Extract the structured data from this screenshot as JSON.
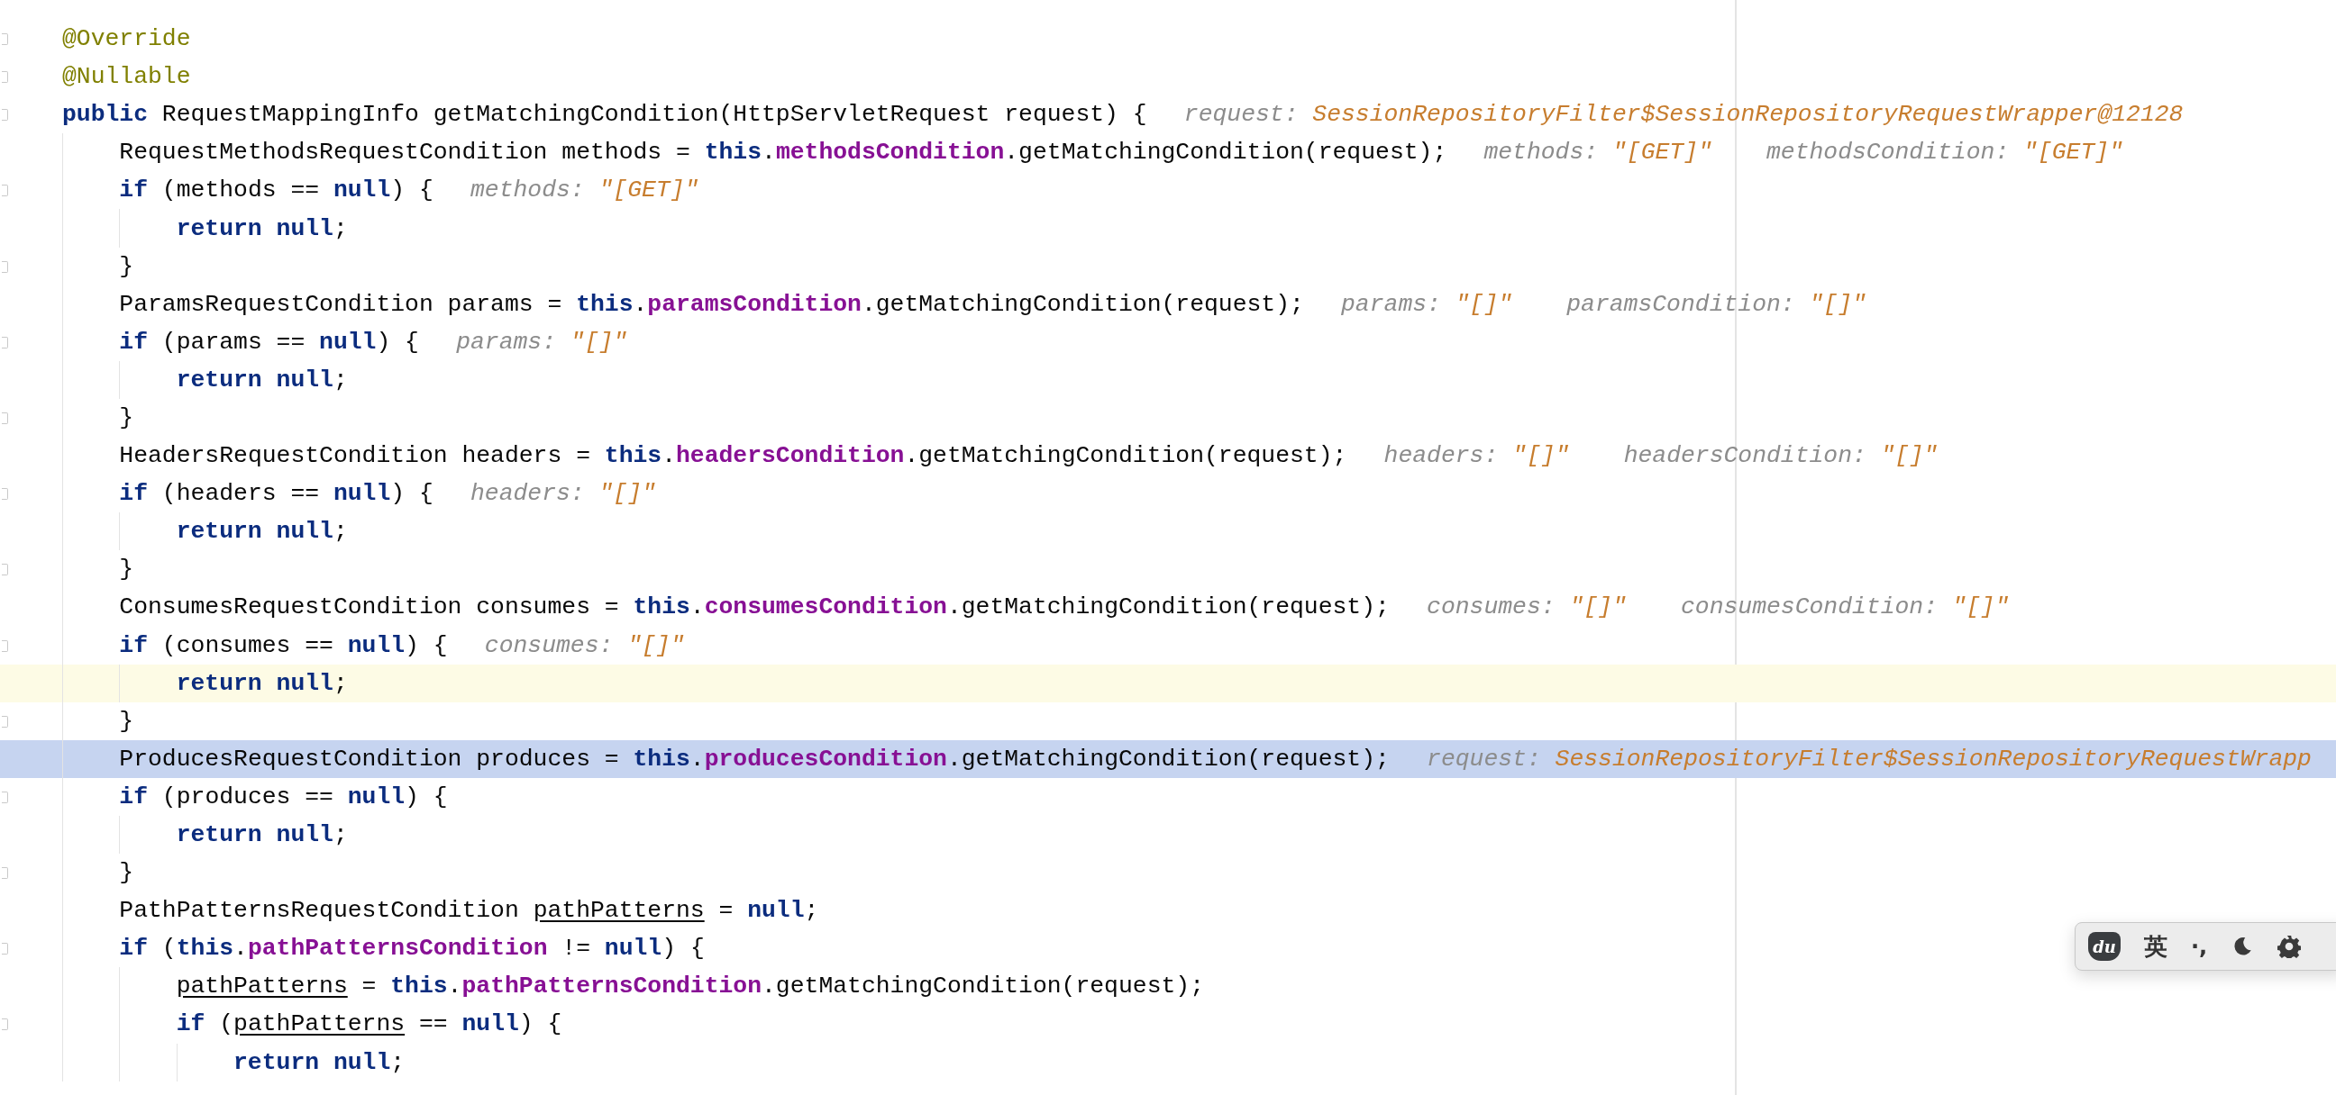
{
  "editor": {
    "lines": [
      {
        "foldable": true,
        "current_line": false,
        "execution_point": false,
        "code": [
          {
            "kind": "annotation",
            "text": "@Override"
          }
        ]
      },
      {
        "foldable": true,
        "current_line": false,
        "execution_point": false,
        "code": [
          {
            "kind": "annotation",
            "text": "@Nullable"
          }
        ]
      },
      {
        "foldable": true,
        "current_line": false,
        "execution_point": false,
        "code": [
          {
            "kind": "keyword",
            "text": "public"
          },
          {
            "kind": "plain",
            "text": " RequestMappingInfo getMatchingCondition(HttpServletRequest request) {"
          }
        ],
        "hints": [
          {
            "name": "request:",
            "value": "SessionRepositoryFilter$SessionRepositoryRequestWrapper@12128"
          }
        ],
        "children": [
          {
            "foldable": false,
            "current_line": false,
            "execution_point": false,
            "code": [
              {
                "kind": "plain",
                "text": "RequestMethodsRequestCondition methods = "
              },
              {
                "kind": "keyword",
                "text": "this"
              },
              {
                "kind": "plain",
                "text": "."
              },
              {
                "kind": "field",
                "text": "methodsCondition"
              },
              {
                "kind": "plain",
                "text": ".getMatchingCondition(request);"
              }
            ],
            "hints": [
              {
                "name": "methods:",
                "value": "\"[GET]\""
              },
              {
                "name": "methodsCondition:",
                "value": "\"[GET]\""
              }
            ]
          },
          {
            "foldable": true,
            "current_line": false,
            "execution_point": false,
            "code": [
              {
                "kind": "keyword",
                "text": "if"
              },
              {
                "kind": "plain",
                "text": " (methods == "
              },
              {
                "kind": "keyword",
                "text": "null"
              },
              {
                "kind": "plain",
                "text": ") {"
              }
            ],
            "hints": [
              {
                "name": "methods:",
                "value": "\"[GET]\""
              }
            ],
            "children": [
              {
                "foldable": false,
                "current_line": false,
                "execution_point": false,
                "code": [
                  {
                    "kind": "keyword",
                    "text": "return null"
                  },
                  {
                    "kind": "plain",
                    "text": ";"
                  }
                ]
              }
            ]
          },
          {
            "foldable": true,
            "current_line": false,
            "execution_point": false,
            "code": [
              {
                "kind": "plain",
                "text": "}"
              }
            ]
          },
          {
            "foldable": false,
            "current_line": false,
            "execution_point": false,
            "code": [
              {
                "kind": "plain",
                "text": "ParamsRequestCondition params = "
              },
              {
                "kind": "keyword",
                "text": "this"
              },
              {
                "kind": "plain",
                "text": "."
              },
              {
                "kind": "field",
                "text": "paramsCondition"
              },
              {
                "kind": "plain",
                "text": ".getMatchingCondition(request);"
              }
            ],
            "hints": [
              {
                "name": "params:",
                "value": "\"[]\""
              },
              {
                "name": "paramsCondition:",
                "value": "\"[]\""
              }
            ]
          },
          {
            "foldable": true,
            "current_line": false,
            "execution_point": false,
            "code": [
              {
                "kind": "keyword",
                "text": "if"
              },
              {
                "kind": "plain",
                "text": " (params == "
              },
              {
                "kind": "keyword",
                "text": "null"
              },
              {
                "kind": "plain",
                "text": ") {"
              }
            ],
            "hints": [
              {
                "name": "params:",
                "value": "\"[]\""
              }
            ],
            "children": [
              {
                "foldable": false,
                "current_line": false,
                "execution_point": false,
                "code": [
                  {
                    "kind": "keyword",
                    "text": "return null"
                  },
                  {
                    "kind": "plain",
                    "text": ";"
                  }
                ]
              }
            ]
          },
          {
            "foldable": true,
            "current_line": false,
            "execution_point": false,
            "code": [
              {
                "kind": "plain",
                "text": "}"
              }
            ]
          },
          {
            "foldable": false,
            "current_line": false,
            "execution_point": false,
            "code": [
              {
                "kind": "plain",
                "text": "HeadersRequestCondition headers = "
              },
              {
                "kind": "keyword",
                "text": "this"
              },
              {
                "kind": "plain",
                "text": "."
              },
              {
                "kind": "field",
                "text": "headersCondition"
              },
              {
                "kind": "plain",
                "text": ".getMatchingCondition(request);"
              }
            ],
            "hints": [
              {
                "name": "headers:",
                "value": "\"[]\""
              },
              {
                "name": "headersCondition:",
                "value": "\"[]\""
              }
            ]
          },
          {
            "foldable": true,
            "current_line": false,
            "execution_point": false,
            "code": [
              {
                "kind": "keyword",
                "text": "if"
              },
              {
                "kind": "plain",
                "text": " (headers == "
              },
              {
                "kind": "keyword",
                "text": "null"
              },
              {
                "kind": "plain",
                "text": ") {"
              }
            ],
            "hints": [
              {
                "name": "headers:",
                "value": "\"[]\""
              }
            ],
            "children": [
              {
                "foldable": false,
                "current_line": false,
                "execution_point": false,
                "code": [
                  {
                    "kind": "keyword",
                    "text": "return null"
                  },
                  {
                    "kind": "plain",
                    "text": ";"
                  }
                ]
              }
            ]
          },
          {
            "foldable": true,
            "current_line": false,
            "execution_point": false,
            "code": [
              {
                "kind": "plain",
                "text": "}"
              }
            ]
          },
          {
            "foldable": false,
            "current_line": false,
            "execution_point": false,
            "code": [
              {
                "kind": "plain",
                "text": "ConsumesRequestCondition consumes = "
              },
              {
                "kind": "keyword",
                "text": "this"
              },
              {
                "kind": "plain",
                "text": "."
              },
              {
                "kind": "field",
                "text": "consumesCondition"
              },
              {
                "kind": "plain",
                "text": ".getMatchingCondition(request);"
              }
            ],
            "hints": [
              {
                "name": "consumes:",
                "value": "\"[]\""
              },
              {
                "name": "consumesCondition:",
                "value": "\"[]\""
              }
            ]
          },
          {
            "foldable": true,
            "current_line": false,
            "execution_point": false,
            "code": [
              {
                "kind": "keyword",
                "text": "if"
              },
              {
                "kind": "plain",
                "text": " (consumes == "
              },
              {
                "kind": "keyword",
                "text": "null"
              },
              {
                "kind": "plain",
                "text": ") {"
              }
            ],
            "hints": [
              {
                "name": "consumes:",
                "value": "\"[]\""
              }
            ],
            "children": [
              {
                "foldable": false,
                "current_line": true,
                "execution_point": false,
                "code": [
                  {
                    "kind": "keyword",
                    "text": "return null"
                  },
                  {
                    "kind": "plain",
                    "text": ";"
                  }
                ]
              }
            ]
          },
          {
            "foldable": true,
            "current_line": false,
            "execution_point": false,
            "code": [
              {
                "kind": "plain",
                "text": "}"
              }
            ]
          },
          {
            "foldable": false,
            "current_line": false,
            "execution_point": true,
            "code": [
              {
                "kind": "plain",
                "text": "ProducesRequestCondition produces = "
              },
              {
                "kind": "keyword",
                "text": "this"
              },
              {
                "kind": "plain",
                "text": "."
              },
              {
                "kind": "field",
                "text": "producesCondition"
              },
              {
                "kind": "plain",
                "text": ".getMatchingCondition(request);"
              }
            ],
            "hints": [
              {
                "name": "request:",
                "value": "SessionRepositoryFilter$SessionRepositoryRequestWrapp"
              }
            ]
          },
          {
            "foldable": true,
            "current_line": false,
            "execution_point": false,
            "code": [
              {
                "kind": "keyword",
                "text": "if"
              },
              {
                "kind": "plain",
                "text": " (produces == "
              },
              {
                "kind": "keyword",
                "text": "null"
              },
              {
                "kind": "plain",
                "text": ") {"
              }
            ],
            "children": [
              {
                "foldable": false,
                "current_line": false,
                "execution_point": false,
                "code": [
                  {
                    "kind": "keyword",
                    "text": "return null"
                  },
                  {
                    "kind": "plain",
                    "text": ";"
                  }
                ]
              }
            ]
          },
          {
            "foldable": true,
            "current_line": false,
            "execution_point": false,
            "code": [
              {
                "kind": "plain",
                "text": "}"
              }
            ]
          },
          {
            "foldable": false,
            "current_line": false,
            "execution_point": false,
            "code": [
              {
                "kind": "plain",
                "text": "PathPatternsRequestCondition "
              },
              {
                "kind": "reassigned",
                "text": "pathPatterns"
              },
              {
                "kind": "plain",
                "text": " = "
              },
              {
                "kind": "keyword",
                "text": "null"
              },
              {
                "kind": "plain",
                "text": ";"
              }
            ]
          },
          {
            "foldable": true,
            "current_line": false,
            "execution_point": false,
            "code": [
              {
                "kind": "keyword",
                "text": "if"
              },
              {
                "kind": "plain",
                "text": " ("
              },
              {
                "kind": "keyword",
                "text": "this"
              },
              {
                "kind": "plain",
                "text": "."
              },
              {
                "kind": "field",
                "text": "pathPatternsCondition"
              },
              {
                "kind": "plain",
                "text": " != "
              },
              {
                "kind": "keyword",
                "text": "null"
              },
              {
                "kind": "plain",
                "text": ") {"
              }
            ],
            "children": [
              {
                "foldable": false,
                "current_line": false,
                "execution_point": false,
                "code": [
                  {
                    "kind": "reassigned",
                    "text": "pathPatterns"
                  },
                  {
                    "kind": "plain",
                    "text": " = "
                  },
                  {
                    "kind": "keyword",
                    "text": "this"
                  },
                  {
                    "kind": "plain",
                    "text": "."
                  },
                  {
                    "kind": "field",
                    "text": "pathPatternsCondition"
                  },
                  {
                    "kind": "plain",
                    "text": ".getMatchingCondition(request);"
                  }
                ]
              },
              {
                "foldable": true,
                "current_line": false,
                "execution_point": false,
                "code": [
                  {
                    "kind": "keyword",
                    "text": "if"
                  },
                  {
                    "kind": "plain",
                    "text": " ("
                  },
                  {
                    "kind": "reassigned",
                    "text": "pathPatterns"
                  },
                  {
                    "kind": "plain",
                    "text": " == "
                  },
                  {
                    "kind": "keyword",
                    "text": "null"
                  },
                  {
                    "kind": "plain",
                    "text": ") {"
                  }
                ],
                "children": [
                  {
                    "foldable": false,
                    "current_line": false,
                    "execution_point": false,
                    "code": [
                      {
                        "kind": "keyword",
                        "text": "return null"
                      },
                      {
                        "kind": "plain",
                        "text": ";"
                      }
                    ]
                  }
                ]
              }
            ]
          }
        ]
      }
    ]
  },
  "ime_toolbar": {
    "logo_text": "du",
    "mode": "英",
    "punctuation": "·,"
  }
}
